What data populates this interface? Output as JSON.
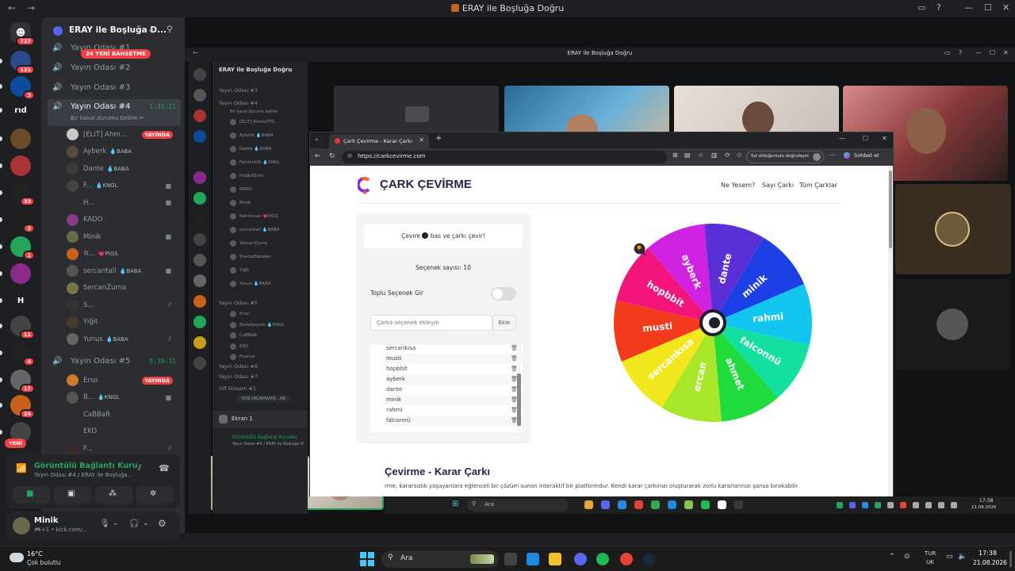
{
  "window": {
    "title": "ERAY ile Boşluğa Doğru",
    "back": "←",
    "forward": "→"
  },
  "rail": {
    "dm_badge": "727",
    "servers": [
      {
        "label": "",
        "badge": "121",
        "color": "#2a4a8a"
      },
      {
        "label": "",
        "badge": "3",
        "color": "#0b4d9a"
      },
      {
        "label": "rıd",
        "badge": "",
        "color": "#1e1f22"
      },
      {
        "label": "",
        "badge": "",
        "color": "#6b4a2a"
      },
      {
        "label": "",
        "badge": "",
        "color": "#a33"
      },
      {
        "label": "",
        "badge": "33",
        "color": "#222"
      },
      {
        "label": "",
        "badge": "2",
        "color": "#1f1f1f"
      },
      {
        "label": "",
        "badge": "1",
        "color": "#23a55a"
      },
      {
        "label": "",
        "badge": "",
        "color": "#8a2a8a"
      },
      {
        "label": "H",
        "badge": "",
        "color": "#1e1f22"
      },
      {
        "label": "",
        "badge": "11",
        "color": "#444"
      },
      {
        "label": "",
        "badge": "4",
        "color": "#222"
      },
      {
        "label": "",
        "badge": "17",
        "color": "#666"
      },
      {
        "label": "",
        "badge": "24",
        "color": "#c8621a"
      },
      {
        "label": "",
        "badge": "",
        "color": "#444"
      }
    ],
    "new_label": "YENİ"
  },
  "server": {
    "name": "ERAY ile Boşluğa D...",
    "new_mentions": "24 YENİ BAHSETME"
  },
  "channels": [
    {
      "name": "Yayın Odası #1"
    },
    {
      "name": "Yayın Odası #2"
    },
    {
      "name": "Yayın Odası #3"
    },
    {
      "name": "Yayın Odası #4",
      "time": "1:31:21",
      "status": "Bir kanal durumu belirle ✏"
    },
    {
      "name": "Yayın Odası #5",
      "time": "9:39:11"
    }
  ],
  "room4_users": [
    {
      "name": "[ELIT] Ahm...",
      "tag": "",
      "live": "YAYINDA",
      "color": "#c9c9c9"
    },
    {
      "name": "Ayberk",
      "tag": "💧BABA",
      "color": "#5a4a3a"
    },
    {
      "name": "Dante",
      "tag": "💧BABA",
      "color": "#3a3a3a"
    },
    {
      "name": "F...",
      "tag": "💧KNGL",
      "color": "#444"
    },
    {
      "name": "H...",
      "tag": "",
      "color": "#2b2d31"
    },
    {
      "name": "KADO",
      "tag": "",
      "color": "#8a3a8a"
    },
    {
      "name": "Minik",
      "tag": "",
      "color": "#6a6a4a"
    },
    {
      "name": "ℝ...",
      "tag": "💗PIGS",
      "color": "#c8621a"
    },
    {
      "name": "sercantall",
      "tag": "💧BABA",
      "color": "#555"
    },
    {
      "name": "SercanZurna",
      "tag": "",
      "color": "#774"
    },
    {
      "name": "S...",
      "tag": "",
      "color": "#333"
    },
    {
      "name": "Yiğit",
      "tag": "",
      "color": "#4a3a2a"
    },
    {
      "name": "Yunus",
      "tag": "💧BABA",
      "color": "#666"
    }
  ],
  "room5_users": [
    {
      "name": "Erso",
      "tag": "",
      "live": "YAYINDA",
      "color": "#c87a2a"
    },
    {
      "name": "B...",
      "tag": "💧KNGL",
      "color": "#555"
    },
    {
      "name": "CaBBaR",
      "tag": "",
      "color": "#2b2d31"
    },
    {
      "name": "EKO",
      "tag": "",
      "color": "#2b2d31"
    },
    {
      "name": "F...",
      "tag": "",
      "color": "#3a2a2a"
    }
  ],
  "voice": {
    "status": "Görüntülü Bağlantı Kuruldu",
    "channel": "Yayın Odası #4 / ERAY ile Boşluğa..."
  },
  "user": {
    "name": "Minik",
    "sub": "🎮+1 • kick.com/..."
  },
  "stream": {
    "title": "ERAY ile Boşluğa Doğru",
    "nested_server": "ERAY ile Boşluğa Doğru",
    "nested_channels": [
      "Yayın Odası #3",
      "Yayın Odası #4",
      "Yayın Odası #5",
      "Yayın Odası #6",
      "Yayın Odası #7",
      "Off Stream #1"
    ],
    "nested_status": "Bir kanal durumu belirle",
    "nested_users": [
      "[ELIT] AhmetTO...",
      "Ayberk 💧BABA",
      "Dante 💧BABA",
      "Falcone2k 💧KNGL",
      "HobbitEmo",
      "KADO",
      "Minik",
      "Rahmican 💗PIGS",
      "sercantall 💧BABA",
      "SercanZurna",
      "StarbeBataker",
      "Yiğit",
      "Yunus 💧BABA"
    ],
    "nested_users5": [
      "Erso",
      "BoneSaures 💧KNGL",
      "CaBBaR",
      "EKO",
      "Fluenzr"
    ],
    "nested_unread": "YENİ OKUNMAMIŞ ..AR",
    "nested_screen": "Ekran 1",
    "nested_voice": "Görüntülü Bağlantı Kuruldu",
    "nested_voice_sub": "Yayın Odası #4 / ERAY ile Boşluğa Doğ..."
  },
  "browser": {
    "tab_title": "Çark Çevirme - Karar Çarkı",
    "url": "https://carkcevirme.com",
    "verify": "Sız olduğunuzu doğrulayın",
    "chat": "Sohbet et"
  },
  "site": {
    "logo": "ÇARK ÇEVİRME",
    "nav": [
      "Ne Yesem?",
      "Sayı Çarkı",
      "Tüm Çarklar"
    ],
    "instruction_pre": "Çevire",
    "instruction_post": "bas ve çarkı çevir!",
    "count": "Seçenek sayısı: 10",
    "bulk": "Toplu Seçenek Gir",
    "add_placeholder": "Çarka seçenek ekleyin",
    "add_button": "Ekle",
    "options": [
      "sercankısa",
      "musti",
      "hopbbit",
      "ayberk",
      "dante",
      "minik",
      "rahmi",
      "falconnü"
    ],
    "heading": "Çevirme - Karar Çarkı",
    "desc": "rme, kararsızlık yaşayanlara eğlenceli bir çözüm sunan interaktif bir platformdur. Kendi karar çarkınızı oluşturarak zorlu kararlarınızı şansa bırakabilir"
  },
  "wheel": {
    "segments": [
      {
        "label": "dante",
        "color": "#5b2fd6"
      },
      {
        "label": "minik",
        "color": "#1d3fe6"
      },
      {
        "label": "rahmi",
        "color": "#12c6f0"
      },
      {
        "label": "falconnü",
        "color": "#13e0a0"
      },
      {
        "label": "ahmet",
        "color": "#1fdc3c"
      },
      {
        "label": "ercan",
        "color": "#a8e62a"
      },
      {
        "label": "sercankısa",
        "color": "#f2e61c"
      },
      {
        "label": "musti",
        "color": "#f23a1c"
      },
      {
        "label": "hopbbit",
        "color": "#f2147a"
      },
      {
        "label": "ayberk",
        "color": "#cf22e0"
      }
    ]
  },
  "inner_taskbar": {
    "search": "Ara",
    "time": "17:38",
    "date": "21.08.2026"
  },
  "taskbar": {
    "weather_temp": "16°C",
    "weather_desc": "Çok bulutlu",
    "search": "Ara",
    "lang": "TUR",
    "lang2": "UK",
    "time": "17:38",
    "date": "21.08.2026"
  }
}
